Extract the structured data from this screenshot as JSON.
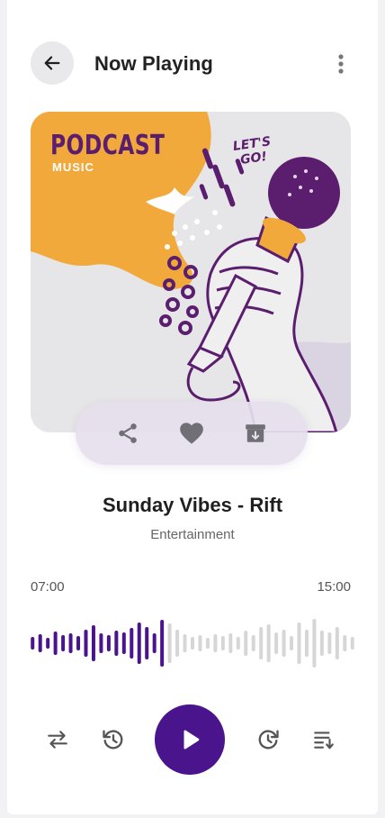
{
  "header": {
    "title": "Now Playing",
    "back_icon": "arrow-left-icon",
    "more_icon": "more-vertical-icon"
  },
  "cover": {
    "brand": "PODCAST",
    "sub": "MUSIC",
    "tag_line1": "LET'S",
    "tag_line2": "GO!"
  },
  "actions": {
    "share_icon": "share-icon",
    "like_icon": "heart-icon",
    "download_icon": "download-icon"
  },
  "track": {
    "title": "Sunday Vibes - Rift",
    "genre": "Entertainment",
    "current_time": "07:00",
    "total_time": "15:00",
    "progress": 0.42
  },
  "controls": {
    "repeat_icon": "repeat-icon",
    "rewind_icon": "rewind-icon",
    "play_icon": "play-icon",
    "forward_icon": "forward-icon",
    "queue_icon": "queue-icon"
  },
  "colors": {
    "accent": "#4a148c",
    "wave_played": "#4a148c",
    "wave_unplayed": "#d6d6d6",
    "cover_orange": "#f2a93b",
    "cover_purple": "#5b1e6e"
  }
}
